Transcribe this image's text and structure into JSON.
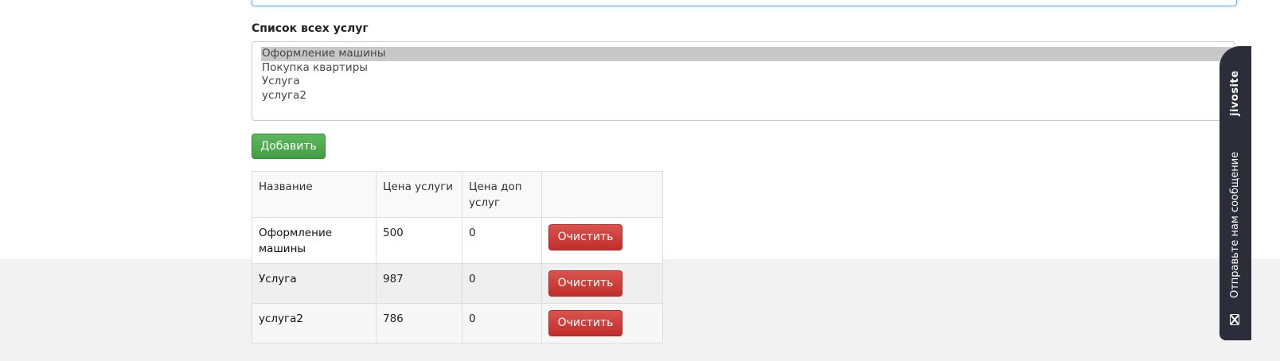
{
  "services_section": {
    "label": "Список всех услуг",
    "options": [
      "Оформление машины",
      "Покупка квартиры",
      "Услуга",
      "услуга2"
    ],
    "selected_option": "Оформление машины"
  },
  "add_button_label": "Добавить",
  "table": {
    "headers": [
      "Название",
      "Цена услуги",
      "Цена доп услуг",
      ""
    ],
    "rows": [
      {
        "name": "Оформление машины",
        "price": "500",
        "extra_price": "0",
        "action": "Очистить"
      },
      {
        "name": "Услуга",
        "price": "987",
        "extra_price": "0",
        "action": "Очистить"
      },
      {
        "name": "услуга2",
        "price": "786",
        "extra_price": "0",
        "action": "Очистить"
      }
    ]
  },
  "chat_widget": {
    "brand": "jivosite",
    "cta": "Отправьте нам сообщение",
    "icon": "envelope-icon",
    "bg_color": "#2b2d38"
  },
  "colors": {
    "add_button": "#5cb85c",
    "clear_button": "#d9534f",
    "input_focus_border": "#66afe9"
  }
}
